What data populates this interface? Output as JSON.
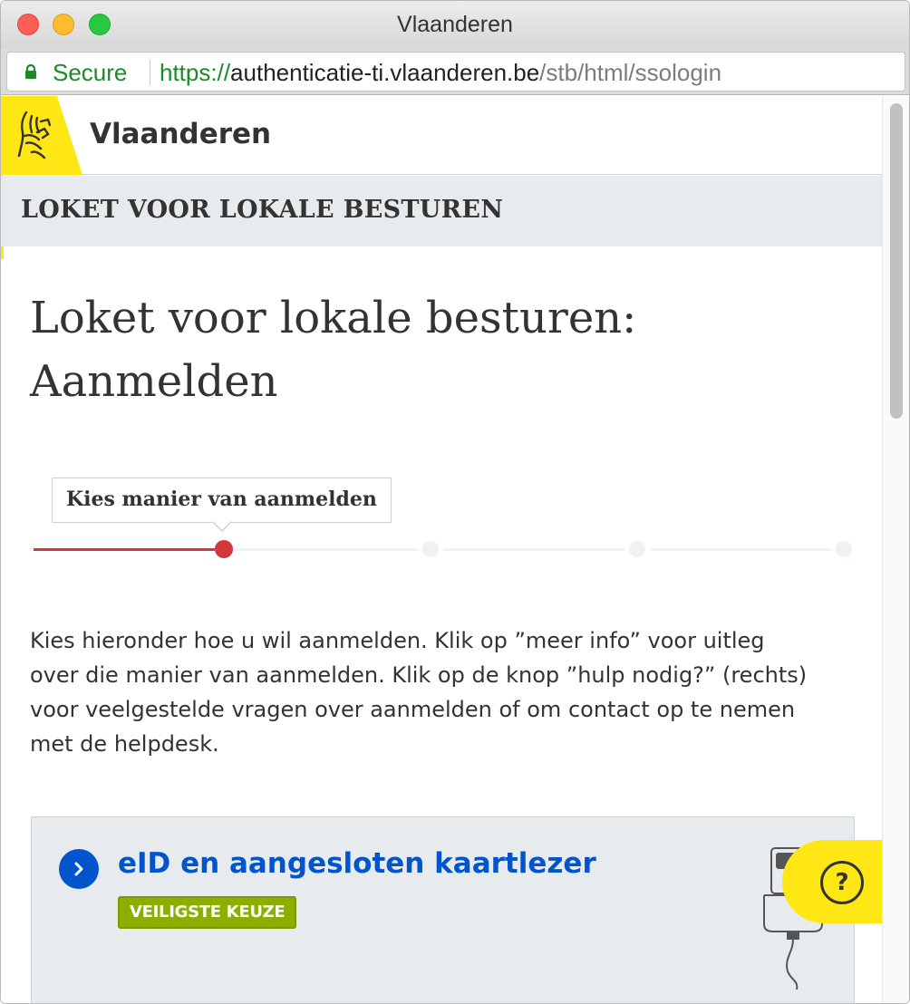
{
  "window": {
    "title": "Vlaanderen"
  },
  "address_bar": {
    "secure_label": "Secure",
    "url_scheme": "https://",
    "url_host": "authenticatie-ti.vlaanderen.be",
    "url_path": "/stb/html/ssologin"
  },
  "header": {
    "brand": "Vlaanderen",
    "logo_icon": "flemish-lion-icon"
  },
  "subheader": {
    "title": "LOKET VOOR LOKALE BESTUREN"
  },
  "page": {
    "title_line1": "Loket voor lokale besturen:",
    "title_line2": "Aanmelden"
  },
  "steps": {
    "current_label": "Kies manier van aanmelden",
    "current_step": 1,
    "total_steps": 4
  },
  "intro": {
    "line1": "Kies hieronder hoe u wil aanmelden. Klik op ”meer info” voor uitleg",
    "line2": "over die manier van aanmelden. Klik op de knop ”hulp nodig?” (rechts)",
    "line3": "voor veelgestelde vragen over aanmelden of om contact op te nemen",
    "line4": "met de helpdesk."
  },
  "login_option": {
    "title": "eID en aangesloten kaartlezer",
    "badge": "VEILIGSTE KEUZE",
    "icon": "card-reader-icon"
  },
  "help_button": {
    "symbol": "?"
  },
  "colors": {
    "flanders_yellow": "#ffe615",
    "link_blue": "#0055cc",
    "progress_red": "#d2373c",
    "badge_green": "#8bae00",
    "panel_grey": "#e8ebee"
  }
}
